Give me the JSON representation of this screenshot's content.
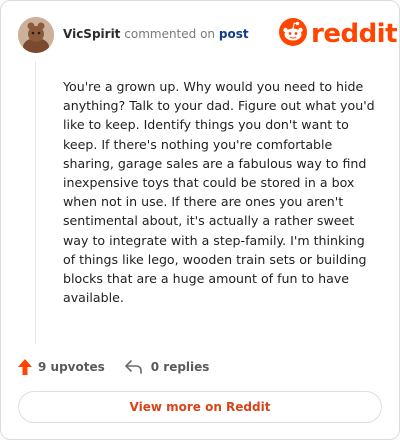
{
  "header": {
    "username": "VicSpirit",
    "action_text": "commented on",
    "post_link": "post"
  },
  "brand": {
    "name": "reddit",
    "icon": "reddit-snoo-icon",
    "color": "#ff4500"
  },
  "comment": {
    "body": "You're a grown up. Why would you need to hide anything? Talk to your dad. Figure out what you'd like to keep. Identify things you don't want to keep. If there's nothing you're comfortable sharing, garage sales are a fabulous way to find inexpensive toys that could be stored in a box when not in use. If there are ones you aren't sentimental about, it's actually a rather sweet way to integrate with a step-family. I'm thinking of things like lego, wooden train sets or building blocks that are a huge amount of fun to have available."
  },
  "actions": {
    "upvotes": "9 upvotes",
    "upvote_icon": "upvote-arrow-icon",
    "upvote_color": "#ff4500",
    "replies": "0 replies",
    "reply_icon": "reply-arrow-icon"
  },
  "footer": {
    "view_more": "View more on Reddit",
    "link_color": "#d7451a"
  }
}
